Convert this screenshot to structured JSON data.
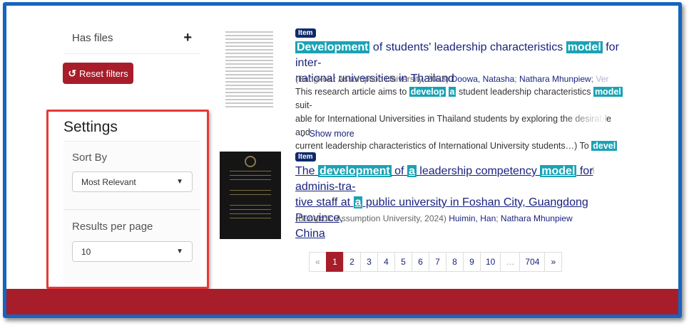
{
  "sidebar": {
    "has_files_label": "Has files",
    "has_files_toggle": "+",
    "reset_label": "Reset filters",
    "reset_icon": "undo-icon",
    "settings_title": "Settings",
    "sort_by_label": "Sort By",
    "sort_by_value": "Most Relevant",
    "results_per_page_label": "Results per page",
    "results_per_page_value": "10"
  },
  "results": [
    {
      "badge": "Item",
      "title_parts": {
        "p1": "Development",
        "p2": " of students' leadership characteristics ",
        "p3": "model",
        "p4": " for inter-",
        "p5": "national universities in Thailand"
      },
      "publisher": "(Bangkok : Assumption University, 2023)",
      "authors": [
        "Doowa, Natasha",
        "Nathara Mhunpiew",
        "Ver"
      ],
      "abstract_parts": {
        "a1": "This research article aims to ",
        "a2": "develop",
        "a3": "a",
        "a4": " student leadership characteristics ",
        "a5": "model",
        "a6": " suit-",
        "a7": "able for International Universities in Thailand students by exploring the desirable and",
        "a8": "current leadership characteristics of International University students…) To ",
        "a9": "devel"
      },
      "show_more": "Show more"
    },
    {
      "badge": "Item",
      "title_parts": {
        "p1": "The ",
        "p2": "development",
        "p3": " of ",
        "p4": "a",
        "p5": " leadership competency ",
        "p6": "model",
        "p7": " for adminis-tra-",
        "p8": "tive staff at ",
        "p9": "a",
        "p10": " public university in Foshan City, Guangdong Province,",
        "p11": "China"
      },
      "publisher": "(Bangkok: Assumption University, 2024)",
      "authors": [
        "Huimin, Han",
        "Nathara Mhunpiew"
      ]
    }
  ],
  "pagination": {
    "prev": "«",
    "pages": [
      "1",
      "2",
      "3",
      "4",
      "5",
      "6",
      "7",
      "8",
      "9",
      "10",
      "…",
      "704"
    ],
    "next": "»",
    "active": "1"
  },
  "colors": {
    "frame": "#1565c0",
    "highlight_box": "#e53935",
    "brand_red": "#a71d2a",
    "search_highlight": "#1aa2b4"
  }
}
